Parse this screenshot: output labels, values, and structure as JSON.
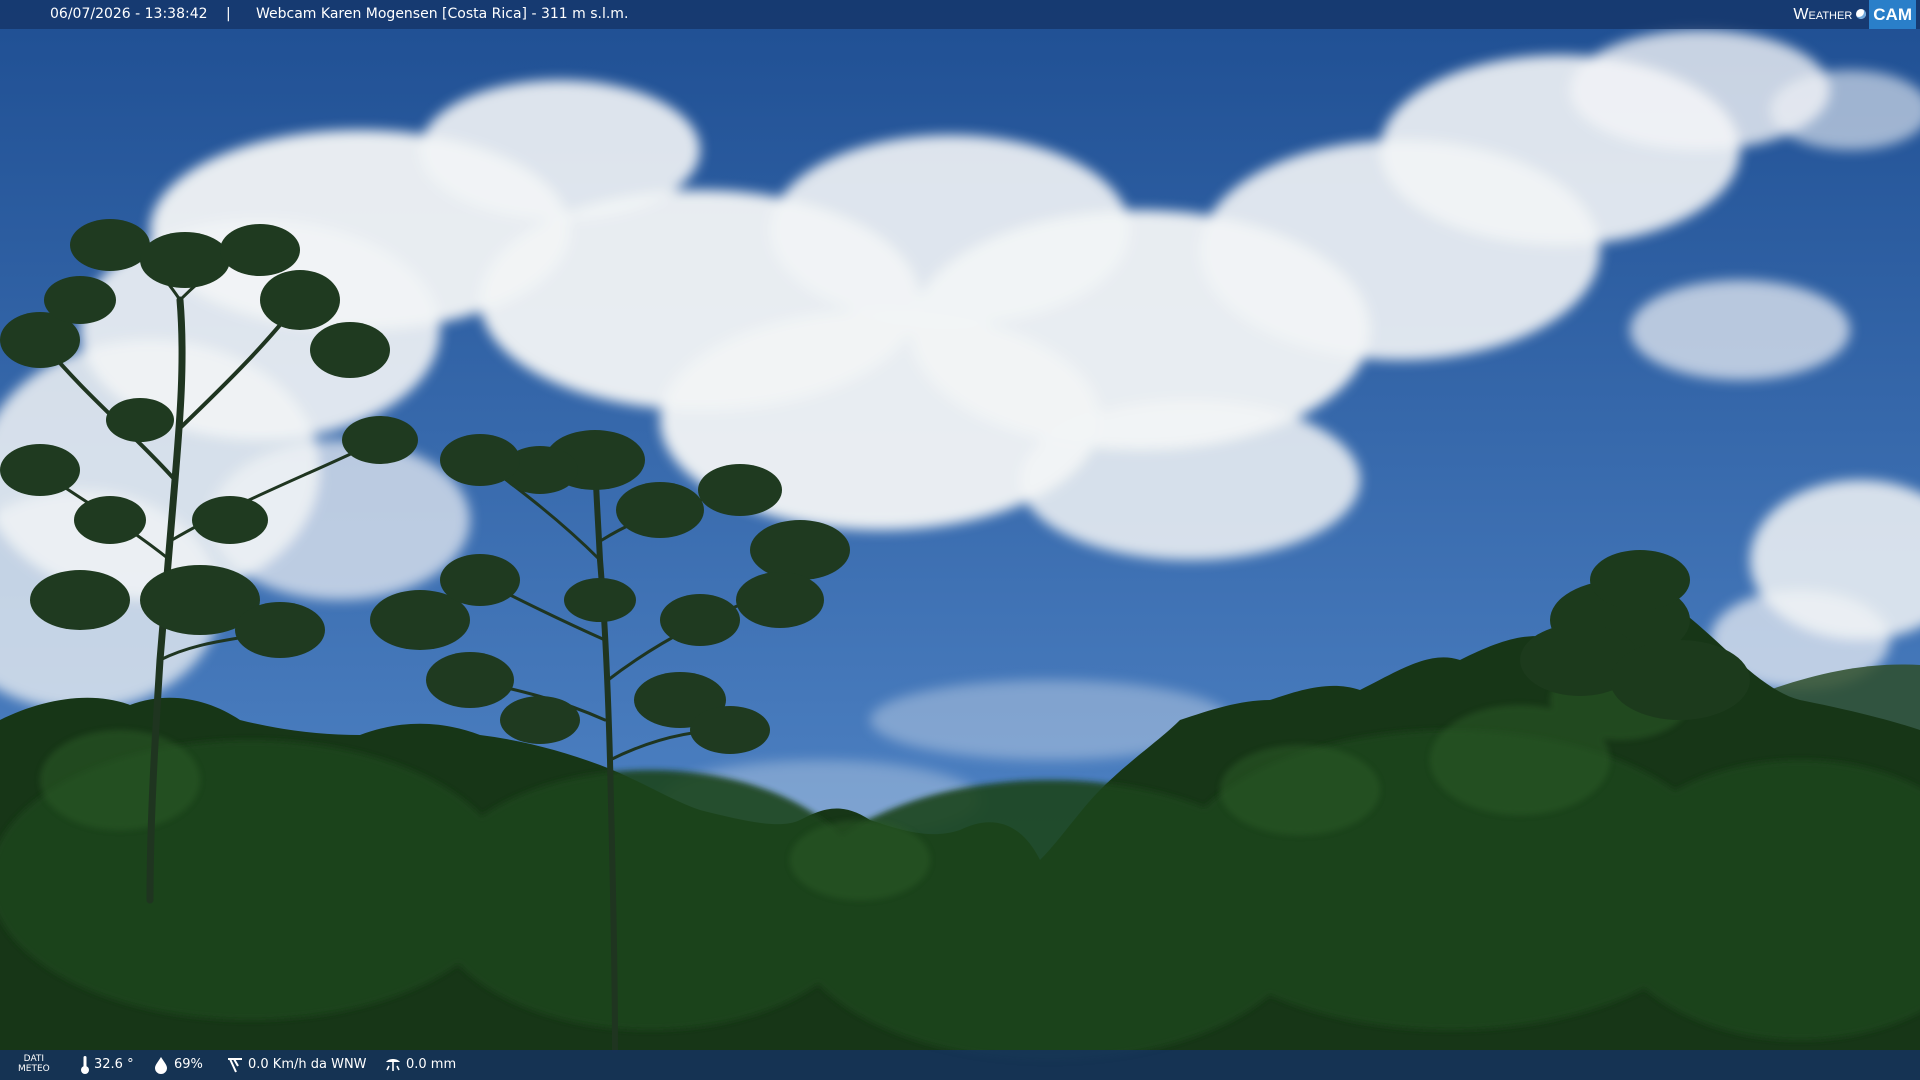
{
  "overlay_top": {
    "timestamp": "06/07/2026 - 13:38:42",
    "separator": "|",
    "title": "Webcam Karen Mogensen [Costa Rica] - 311 m s.l.m.",
    "brand_weather": "Weather",
    "brand_cam": "CAM"
  },
  "overlay_bottom": {
    "label_line1": "DATI",
    "label_line2": "METEO",
    "temperature": "32.6 °",
    "humidity": "69%",
    "wind": "0.0 Km/h da WNW",
    "rain": "0.0 mm"
  },
  "scene": {
    "sky_top_color": "#1f4f93",
    "sky_bottom_color": "#5a8fd0",
    "cloud_color": "#f2f4f6",
    "forest_color": "#173617"
  },
  "icons": {
    "temperature": "thermometer-icon",
    "humidity": "humidity-drop-icon",
    "wind": "wind-icon",
    "rain": "rain-gauge-icon"
  }
}
